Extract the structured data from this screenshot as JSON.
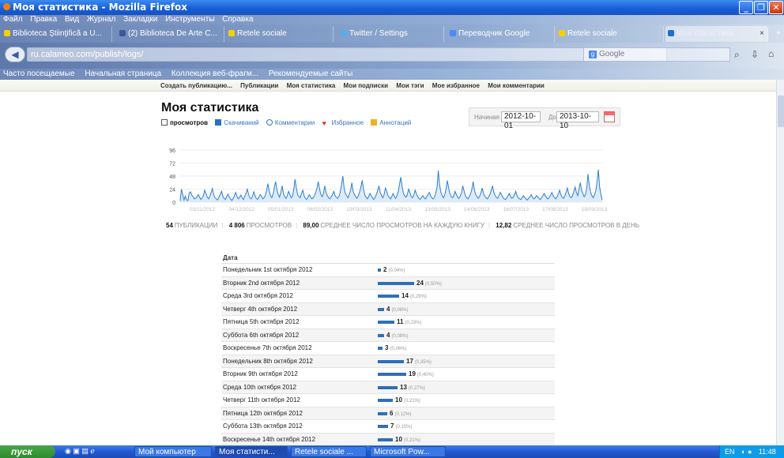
{
  "window": {
    "title": "Моя статистика - Mozilla Firefox"
  },
  "menu": [
    "Файл",
    "Правка",
    "Вид",
    "Журнал",
    "Закладки",
    "Инструменты",
    "Справка"
  ],
  "tabs": [
    {
      "label": "Biblioteca Ştiinţifică a U..."
    },
    {
      "label": "(2) Biblioteca De Arte C..."
    },
    {
      "label": "Retele sociale"
    },
    {
      "label": "Twitter / Settings"
    },
    {
      "label": "Переводчик Google"
    },
    {
      "label": "Retele sociale"
    },
    {
      "label": "Моя статистика"
    }
  ],
  "address": {
    "url": "ru.calameo.com/publish/logs/",
    "search_engine": "Google"
  },
  "bookmarks": [
    "Часто посещаемые",
    "Начальная страница",
    "Коллекция веб-фрагм...",
    "Рекомендуемые сайты"
  ],
  "sitenav": [
    "Создать публикацию...",
    "Публикации",
    "Моя статистика",
    "Мои подписки",
    "Мои тэги",
    "Мое избранное",
    "Мои комментарии"
  ],
  "page": {
    "title": "Моя статистика",
    "metric_tabs": [
      "просмотров",
      "Скачиваний",
      "Комментарии",
      "Избранное",
      "Аннотаций"
    ],
    "date_from_label": "Начиная с",
    "date_from": "2012-10-01",
    "date_to_label": "До",
    "date_to": "2013-10-10"
  },
  "stats": {
    "publications": "54",
    "publications_label": "ПУБЛИКАЦИИ",
    "views": "4 806",
    "views_label": "ПРОСМОТРОВ",
    "avg_per_book": "89,00",
    "avg_per_book_label": "СРЕДНЕЕ ЧИСЛО ПРОСМОТРОВ НА КАЖДУЮ КНИГУ",
    "avg_per_day": "12,82",
    "avg_per_day_label": "СРЕДНЕЕ ЧИСЛО ПРОСМОТРОВ В ДЕНЬ"
  },
  "chart_data": {
    "type": "area",
    "yticks": [
      0,
      24,
      48,
      72,
      96
    ],
    "ylim": [
      0,
      96
    ],
    "xticks": [
      "03/11/2012",
      "04/12/2012",
      "05/01/2013",
      "06/02/2013",
      "10/03/2013",
      "11/04/2013",
      "13/05/2013",
      "14/06/2013",
      "16/07/2013",
      "17/08/2013",
      "18/09/2013"
    ],
    "values": [
      2,
      24,
      14,
      4,
      11,
      4,
      3,
      17,
      19,
      13,
      10,
      6,
      7,
      10,
      14,
      9,
      5,
      8,
      12,
      22,
      16,
      9,
      6,
      11,
      18,
      25,
      13,
      8,
      6,
      4,
      9,
      14,
      20,
      12,
      7,
      5,
      10,
      15,
      9,
      6,
      3,
      7,
      12,
      18,
      10,
      6,
      9,
      13,
      8,
      5,
      11,
      16,
      24,
      14,
      8,
      6,
      10,
      19,
      12,
      7,
      5,
      9,
      14,
      11,
      6,
      8,
      13,
      22,
      34,
      20,
      12,
      8,
      15,
      28,
      38,
      22,
      14,
      9,
      18,
      30,
      16,
      10,
      7,
      12,
      20,
      14,
      8,
      11,
      24,
      42,
      26,
      14,
      10,
      8,
      16,
      22,
      12,
      7,
      5,
      9,
      14,
      10,
      6,
      8,
      12,
      18,
      26,
      38,
      24,
      14,
      10,
      16,
      30,
      18,
      12,
      8,
      6,
      10,
      14,
      20,
      12,
      9,
      7,
      11,
      18,
      32,
      48,
      26,
      16,
      12,
      8,
      14,
      22,
      36,
      20,
      14,
      10,
      7,
      12,
      18,
      28,
      40,
      24,
      14,
      9,
      6,
      10,
      16,
      12,
      8,
      5,
      9,
      14,
      22,
      30,
      18,
      12,
      8,
      14,
      26,
      20,
      12,
      9,
      6,
      11,
      16,
      10,
      7,
      12,
      20,
      34,
      46,
      28,
      16,
      12,
      9,
      14,
      24,
      18,
      10,
      8,
      13,
      22,
      16,
      10,
      7,
      5,
      9,
      12,
      8,
      6,
      10,
      14,
      18,
      12,
      8,
      6,
      9,
      16,
      28,
      58,
      32,
      18,
      12,
      8,
      14,
      24,
      40,
      26,
      16,
      10,
      8,
      12,
      20,
      14,
      9,
      7,
      11,
      18,
      30,
      20,
      12,
      8,
      6,
      10,
      15,
      24,
      38,
      22,
      14,
      10,
      7,
      11,
      17,
      26,
      16,
      11,
      8,
      6,
      10,
      14,
      22,
      30,
      18,
      12,
      9,
      7,
      12,
      18,
      14,
      9,
      6,
      5,
      8,
      12,
      16,
      10,
      7,
      9,
      14,
      20,
      12,
      8,
      6,
      5,
      9,
      12,
      8,
      6,
      4,
      7,
      10,
      14,
      9,
      6,
      8,
      12,
      10,
      7,
      5,
      8,
      12,
      16,
      11,
      8,
      6,
      9,
      13,
      18,
      12,
      8,
      6,
      10,
      15,
      22,
      14,
      9,
      7,
      11,
      18,
      26,
      16,
      10,
      8,
      12,
      20,
      28,
      18,
      12,
      24,
      36,
      22,
      16,
      10,
      14,
      26,
      52,
      30,
      18,
      12,
      8,
      14,
      20,
      38,
      60,
      28,
      14,
      4
    ]
  },
  "table": {
    "header": "Дата",
    "rows": [
      {
        "date": "Понедельник 1st октября 2012",
        "value": "2",
        "pct": "(0,04%)",
        "n": 2
      },
      {
        "date": "Вторник 2nd октября 2012",
        "value": "24",
        "pct": "(0,50%)",
        "n": 24
      },
      {
        "date": "Среда 3rd октября 2012",
        "value": "14",
        "pct": "(0,29%)",
        "n": 14
      },
      {
        "date": "Четверг 4th октября 2012",
        "value": "4",
        "pct": "(0,08%)",
        "n": 4
      },
      {
        "date": "Пятница 5th октября 2012",
        "value": "11",
        "pct": "(0,23%)",
        "n": 11
      },
      {
        "date": "Суббота 6th октября 2012",
        "value": "4",
        "pct": "(0,08%)",
        "n": 4
      },
      {
        "date": "Воскресенье 7th октября 2012",
        "value": "3",
        "pct": "(0,06%)",
        "n": 3
      },
      {
        "date": "Понедельник 8th октября 2012",
        "value": "17",
        "pct": "(0,35%)",
        "n": 17
      },
      {
        "date": "Вторник 9th октября 2012",
        "value": "19",
        "pct": "(0,40%)",
        "n": 19
      },
      {
        "date": "Среда 10th октября 2012",
        "value": "13",
        "pct": "(0,27%)",
        "n": 13
      },
      {
        "date": "Четверг 11th октября 2012",
        "value": "10",
        "pct": "(0,21%)",
        "n": 10
      },
      {
        "date": "Пятница 12th октября 2012",
        "value": "6",
        "pct": "(0,12%)",
        "n": 6
      },
      {
        "date": "Суббота 13th октября 2012",
        "value": "7",
        "pct": "(0,15%)",
        "n": 7
      },
      {
        "date": "Воскресенье 14th октября 2012",
        "value": "10",
        "pct": "(0,21%)",
        "n": 10
      }
    ]
  },
  "taskbar": {
    "start": "пуск",
    "tasks": [
      "Мой компьютер",
      "Моя статисти...",
      "Retele sociale ...",
      "Microsoft Pow..."
    ],
    "lang": "EN",
    "time": "11:48"
  },
  "colors": {
    "chart_line": "#2a7fd4",
    "chart_fill": "#cfe3f5",
    "bar": "#2d6fb8",
    "title_bar": "#1a5fd6"
  }
}
